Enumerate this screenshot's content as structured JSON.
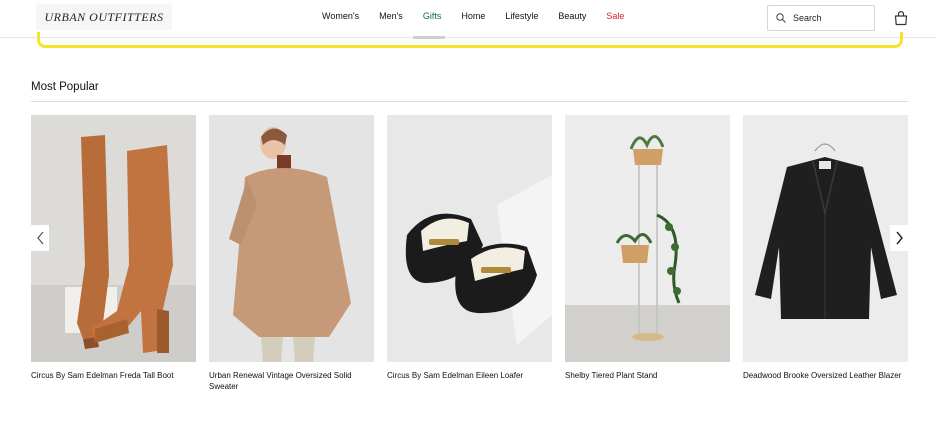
{
  "header": {
    "logo": "URBAN OUTFITTERS",
    "nav": [
      {
        "label": "Women's",
        "name": "nav-womens"
      },
      {
        "label": "Men's",
        "name": "nav-mens"
      },
      {
        "label": "Gifts",
        "name": "nav-gifts"
      },
      {
        "label": "Home",
        "name": "nav-home"
      },
      {
        "label": "Lifestyle",
        "name": "nav-lifestyle"
      },
      {
        "label": "Beauty",
        "name": "nav-beauty"
      },
      {
        "label": "Sale",
        "name": "nav-sale"
      }
    ],
    "search_placeholder": "Search",
    "icons": {
      "search": "search-icon",
      "bag": "shopping-bag-icon"
    }
  },
  "section": {
    "title": "Most Popular",
    "products": [
      {
        "name": "Circus By Sam Edelman Freda Tall Boot"
      },
      {
        "name": "Urban Renewal Vintage Oversized Solid Sweater"
      },
      {
        "name": "Circus By Sam Edelman Eileen Loafer"
      },
      {
        "name": "Shelby Tiered Plant Stand"
      },
      {
        "name": "Deadwood Brooke Oversized Leather Blazer"
      }
    ]
  },
  "colors": {
    "gifts": "#1e6b2e",
    "sale": "#d8232a",
    "banner_border": "#f5e52a"
  }
}
